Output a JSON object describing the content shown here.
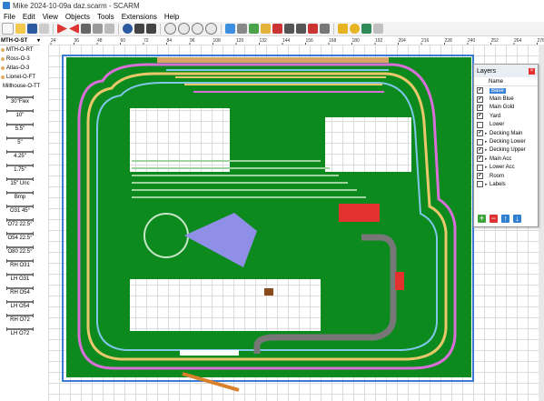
{
  "window": {
    "title": "Mike 2024-10-09a daz.scarm - SCARM"
  },
  "menu": [
    "File",
    "Edit",
    "View",
    "Objects",
    "Tools",
    "Extensions",
    "Help"
  ],
  "library": {
    "header": "MTH-O-ST",
    "items": [
      "MTH-O-RT",
      "Ross-O-3",
      "Atlas-O-3",
      "Lionel-O-FT",
      "Millhouse-O-TT"
    ],
    "symbols": [
      "30\"Flex",
      "10\"",
      "5.5\"",
      "5\"",
      "4.25\"",
      "1.75\"",
      "15\" Unc",
      "Bmp",
      "O31 45°",
      "O72 22.5°",
      "O54 22.5°",
      "O80 22.5°",
      "RH O31",
      "LH O31",
      "RH O54",
      "LH O54",
      "RH O72",
      "LH O72"
    ]
  },
  "ruler": {
    "top": [
      "24",
      "36",
      "48",
      "60",
      "72",
      "84",
      "96",
      "108",
      "120",
      "132",
      "144",
      "156",
      "168",
      "180",
      "192",
      "204",
      "216",
      "228",
      "240",
      "252",
      "264",
      "276"
    ]
  },
  "layers": {
    "title": "Layers",
    "column": "Name",
    "rows": [
      {
        "name": "Base",
        "checked": true,
        "selected": true
      },
      {
        "name": "Main Blue",
        "checked": true
      },
      {
        "name": "Main Gold",
        "checked": true
      },
      {
        "name": "Yard",
        "checked": true
      },
      {
        "name": "Lower",
        "checked": false
      },
      {
        "name": "Decking Main",
        "checked": true
      },
      {
        "name": "Decking Lower",
        "checked": false
      },
      {
        "name": "Decking Upper",
        "checked": true
      },
      {
        "name": "Main Acc",
        "checked": true
      },
      {
        "name": "Lower Acc",
        "checked": false
      },
      {
        "name": "Room",
        "checked": true
      },
      {
        "name": "Labels",
        "checked": false
      }
    ],
    "buttons": {
      "add": "+",
      "remove": "−",
      "up": "↑",
      "down": "↓"
    }
  },
  "colors": {
    "base_green": "#0c8a1e",
    "track_pink": "#d86fd8",
    "track_gold": "#e8c86a",
    "track_blue": "#7fc6e8",
    "road_gray": "#777777",
    "ramp_brown": "#d9822b",
    "yard_red": "#e53030"
  }
}
